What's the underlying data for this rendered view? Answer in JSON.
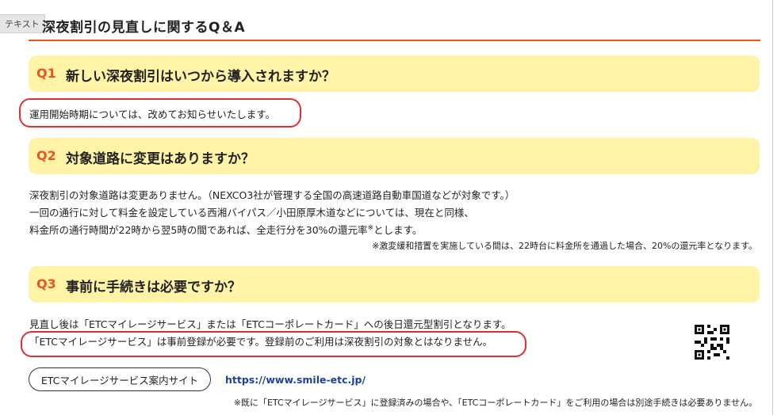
{
  "tag_label": "テキスト",
  "page_title": "深夜割引の見直しに関するQ＆A",
  "q1": {
    "num": "Q1",
    "question": "新しい深夜割引はいつから導入されますか？",
    "answer": "運用開始時期については、改めてお知らせいたします。"
  },
  "q2": {
    "num": "Q2",
    "question": "対象道路に変更はありますか？",
    "line1": "深夜割引の対象道路は変更ありません。（NEXCO3社が管理する全国の高速道路自動車国道などが対象です。）",
    "line2": "一回の通行に対して料金を設定している西湘バイパス／小田原厚木道などについては、現在と同様、",
    "line3": "料金所の通行時間が22時から翌5時の間であれば、全走行分を30%の還元率",
    "line3_mark": "※",
    "line3_end": "とします。",
    "note": "※激変緩和措置を実施している間は、22時台に料金所を通過した場合、20%の還元率となります。"
  },
  "q3": {
    "num": "Q3",
    "question": "事前に手続きは必要ですか？",
    "line1": "見直し後は「ETCマイレージサービス」または「ETCコーポレートカード」への後日還元型割引となります。",
    "line2": "「ETCマイレージサービス」は事前登録が必要です。登録前のご利用は深夜割引の対象とはなりません。",
    "button_label": "ETCマイレージサービス案内サイト",
    "url": "https://www.smile-etc.jp/",
    "note": "※既に「ETCマイレージサービス」に登録済みの場合や、「ETCコーポレートカード」をご利用の場合は別途手続きは必要ありません。"
  },
  "colors": {
    "accent": "#e8551f",
    "question_bg": "#fff3a8",
    "highlight": "#e03030",
    "link": "#1f3f9c"
  },
  "icons": [
    "qr-code-icon"
  ]
}
